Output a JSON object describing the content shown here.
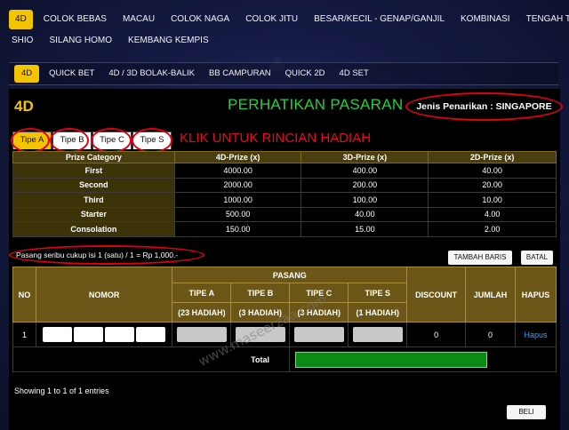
{
  "nav": {
    "row1": [
      "4D",
      "COLOK BEBAS",
      "MACAU",
      "COLOK NAGA",
      "COLOK JITU",
      "BESAR/KECIL - GENAP/GANJIL",
      "KOMBINASI",
      "TENGAH TEPI"
    ],
    "row2": [
      "SHIO",
      "SILANG HOMO",
      "KEMBANG KEMPIS"
    ]
  },
  "subnav": [
    "4D",
    "QUICK BET",
    "4D / 3D BOLAK-BALIK",
    "BB CAMPURAN",
    "QUICK 2D",
    "4D SET"
  ],
  "page": {
    "title": "4D",
    "notice": "PERHATIKAN PASARAN",
    "draw_type": "Jenis Penarikan : SINGAPORE",
    "click_note": "KLIK UNTUK RINCIAN HADIAH"
  },
  "tabs": [
    "Tipe A",
    "Tipe B",
    "Tipe C",
    "Tipe S"
  ],
  "prize_table": {
    "headers": [
      "Prize Category",
      "4D-Prize (x)",
      "3D-Prize (x)",
      "2D-Prize (x)"
    ],
    "rows": [
      [
        "First",
        "4000.00",
        "400.00",
        "40.00"
      ],
      [
        "Second",
        "2000.00",
        "200.00",
        "20.00"
      ],
      [
        "Third",
        "1000.00",
        "100.00",
        "10.00"
      ],
      [
        "Starter",
        "500.00",
        "40.00",
        "4.00"
      ],
      [
        "Consolation",
        "150.00",
        "15.00",
        "2.00"
      ]
    ]
  },
  "pasang_note": "Pasang seribu cukup isi 1 (satu) / 1 = Rp 1,000.-",
  "buttons": {
    "tambah": "TAMBAH BARIS",
    "batal": "BATAL",
    "beli": "BELI"
  },
  "order_table": {
    "no": "NO",
    "nomor": "NOMOR",
    "pasang": "PASANG",
    "types": [
      "TIPE A",
      "TIPE B",
      "TIPE C",
      "TIPE S"
    ],
    "hadiah": [
      "(23 HADIAH)",
      "(3 HADIAH)",
      "(3 HADIAH)",
      "(1 HADIAH)"
    ],
    "discount": "DISCOUNT",
    "jumlah": "JUMLAH",
    "hapus": "HAPUS",
    "row": {
      "no": "1",
      "discount": "0",
      "jumlah": "0",
      "hapus": "Hapus"
    },
    "total_label": "Total"
  },
  "showing": "Showing 1 to 1 of 1 entries",
  "watermark": "www.maseerzaa.com",
  "colors": {
    "accent": "#f2c500",
    "notice": "#23d13a",
    "alert": "#e00010",
    "total_bar": "#0c8a16",
    "link": "#3aa0ff"
  }
}
